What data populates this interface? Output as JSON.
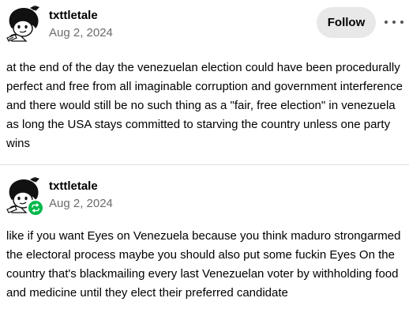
{
  "posts": [
    {
      "username": "txttletale",
      "date": "Aug 2, 2024",
      "follow_label": "Follow",
      "avatar_icon": "mafalda-avatar-icon",
      "more_icon": "more-options-icon",
      "body": "at the end of the day the venezuelan election could have been procedurally perfect and free from all imaginable corruption and government interference and there would still be no such thing as a \"fair, free election\" in venezuela as long the USA stays committed to starving the country unless one party wins"
    },
    {
      "username": "txttletale",
      "date": "Aug 2, 2024",
      "avatar_icon": "mafalda-avatar-icon",
      "badge_icon": "reblog-icon",
      "body": "like if you want Eyes on Venezuela because you think maduro strongarmed the electoral process maybe you should also put some fuckin Eyes On the country that's blackmailing every last Venezuelan voter by withholding food and medicine until they elect their preferred candidate"
    }
  ],
  "colors": {
    "text": "#000000",
    "muted": "#6b6b6b",
    "button_bg": "#e8e8e8",
    "reblog_green": "#00b84a",
    "divider": "#dedede"
  }
}
